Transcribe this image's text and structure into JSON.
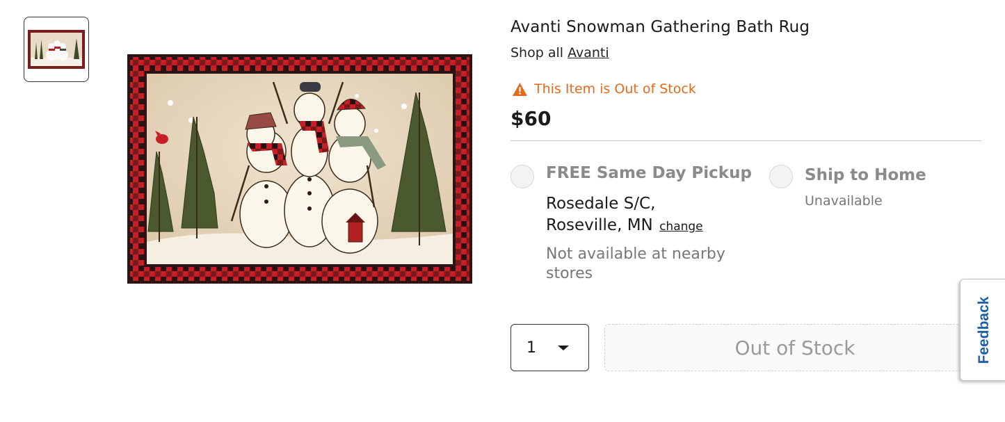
{
  "product": {
    "title": "Avanti Snowman Gathering Bath Rug",
    "shop_all_prefix": "Shop all",
    "brand_link": "Avanti",
    "stock_alert": "This Item is Out of Stock",
    "price": "$60"
  },
  "fulfillment": {
    "pickup": {
      "title": "FREE Same Day Pickup",
      "store": "Rosedale S/C, Roseville, MN",
      "change_link": "change",
      "status": "Not available at nearby stores"
    },
    "ship": {
      "title": "Ship to Home",
      "status": "Unavailable"
    }
  },
  "purchase": {
    "quantity": "1",
    "button_label": "Out of Stock"
  },
  "feedback_tab": "Feedback",
  "colors": {
    "alert": "#e56a1c",
    "feedback_text": "#1e5fa8",
    "rug_red": "#c62026",
    "rug_dark": "#2a1a1a"
  },
  "icons": [
    "warning-icon",
    "chevron-down-icon"
  ]
}
